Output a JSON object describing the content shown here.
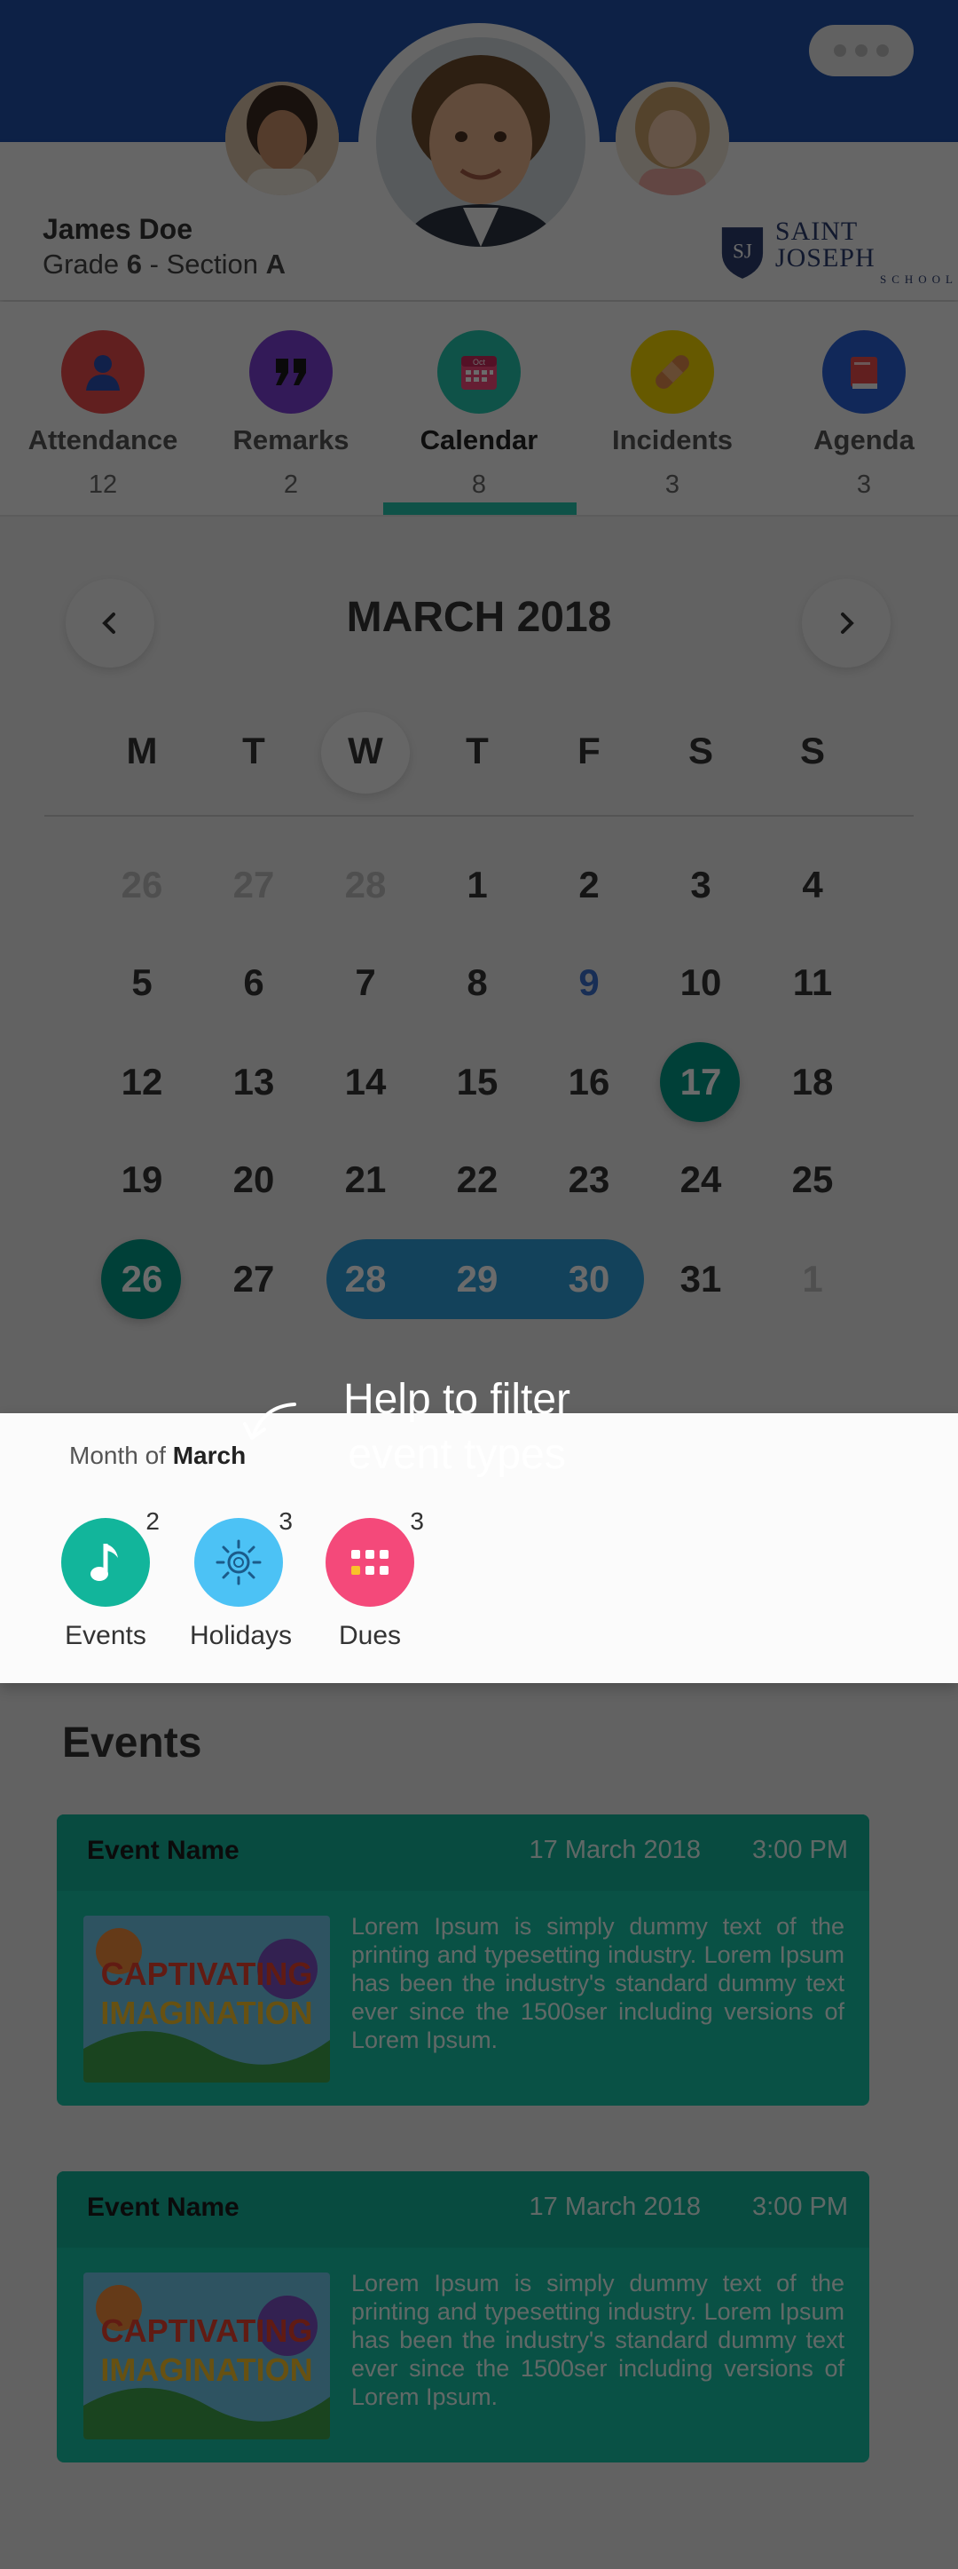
{
  "student": {
    "name": "James Doe",
    "grade_prefix": "Grade ",
    "grade": "6",
    "section_prefix": " - Section ",
    "section": "A"
  },
  "school": {
    "line1": "SAINT JOSEPH",
    "line2": "SCHOOL",
    "monogram": "SJ"
  },
  "tabs": [
    {
      "label": "Attendance",
      "count": "12",
      "color": "#e84a4a",
      "icon": "person-icon"
    },
    {
      "label": "Remarks",
      "count": "2",
      "color": "#7a3fd1",
      "icon": "quote-icon"
    },
    {
      "label": "Calendar",
      "count": "8",
      "color": "#25c4ac",
      "icon": "calendar-icon",
      "icon_text": "Oct",
      "active": true
    },
    {
      "label": "Incidents",
      "count": "3",
      "color": "#f2d400",
      "icon": "bandage-icon"
    },
    {
      "label": "Agenda",
      "count": "3",
      "color": "#2a5fd3",
      "icon": "book-icon"
    }
  ],
  "calendar": {
    "month_title": "MARCH 2018",
    "weekdays": [
      "M",
      "T",
      "W",
      "T",
      "F",
      "S",
      "S"
    ],
    "weeks": [
      [
        "26",
        "27",
        "28",
        "1",
        "2",
        "3",
        "4"
      ],
      [
        "5",
        "6",
        "7",
        "8",
        "9",
        "10",
        "11"
      ],
      [
        "12",
        "13",
        "14",
        "15",
        "16",
        "17",
        "18"
      ],
      [
        "19",
        "20",
        "21",
        "22",
        "23",
        "24",
        "25"
      ],
      [
        "26",
        "27",
        "28",
        "29",
        "30",
        "31",
        "1"
      ]
    ]
  },
  "filter": {
    "month_prefix": "Month of ",
    "month": "March",
    "help_line1": "Help to filter",
    "help_line2": "event types",
    "items": [
      {
        "label": "Events",
        "count": "2",
        "color": "#12b59b",
        "icon": "music-note-icon"
      },
      {
        "label": "Holidays",
        "count": "3",
        "color": "#4cc2f5",
        "icon": "sun-icon"
      },
      {
        "label": "Dues",
        "count": "3",
        "color": "#f4497a",
        "icon": "grid-icon"
      }
    ]
  },
  "events": {
    "title": "Events",
    "cards": [
      {
        "name": "Event Name",
        "date": "17 March 2018",
        "time": "3:00 PM",
        "text": "Lorem Ipsum is simply dummy text of the printing and typesetting industry. Lorem Ipsum has been the industry's standard dummy text ever since the 1500ser including versions of Lorem Ipsum."
      },
      {
        "name": "Event Name",
        "date": "17 March 2018",
        "time": "3:00 PM",
        "text": "Lorem Ipsum is simply dummy text of the printing and typesetting industry. Lorem Ipsum has been the industry's standard dummy text ever since the 1500ser including versions of Lorem Ipsum."
      }
    ],
    "poster_line1": "CAPTIVATING",
    "poster_line2": "IMAGINATION"
  }
}
